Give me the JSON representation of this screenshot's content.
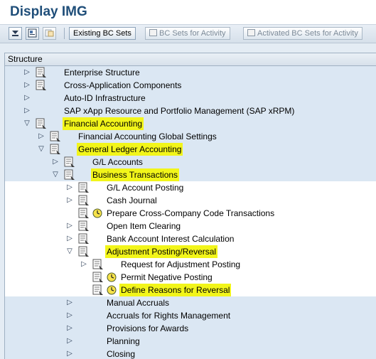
{
  "window": {
    "title": "Display IMG"
  },
  "toolbar": {
    "existing_bc_sets": "Existing BC Sets",
    "bc_sets_for_activity": "BC Sets for Activity",
    "activated_bc_sets_for_activity": "Activated BC Sets for Activity"
  },
  "tree": {
    "header": "Structure",
    "rows": [
      {
        "label": "Enterprise Structure",
        "level": 0,
        "expand": "collapsed",
        "icon": "doc",
        "clock": false,
        "highlight": false,
        "band": true
      },
      {
        "label": "Cross-Application Components",
        "level": 0,
        "expand": "collapsed",
        "icon": "doc",
        "clock": false,
        "highlight": false,
        "band": true
      },
      {
        "label": "Auto-ID Infrastructure",
        "level": 0,
        "expand": "collapsed",
        "icon": "none",
        "clock": false,
        "highlight": false,
        "band": true
      },
      {
        "label": "SAP xApp Resource and Portfolio Management (SAP xRPM)",
        "level": 0,
        "expand": "collapsed",
        "icon": "none",
        "clock": false,
        "highlight": false,
        "band": true
      },
      {
        "label": "Financial Accounting",
        "level": 0,
        "expand": "expanded",
        "icon": "doc",
        "clock": false,
        "highlight": true,
        "band": true
      },
      {
        "label": "Financial Accounting Global Settings",
        "level": 1,
        "expand": "collapsed",
        "icon": "doc",
        "clock": false,
        "highlight": false,
        "band": true
      },
      {
        "label": "General Ledger Accounting",
        "level": 1,
        "expand": "expanded",
        "icon": "doc",
        "clock": false,
        "highlight": true,
        "band": true
      },
      {
        "label": "G/L Accounts",
        "level": 2,
        "expand": "collapsed",
        "icon": "doc",
        "clock": false,
        "highlight": false,
        "band": true
      },
      {
        "label": "Business Transactions",
        "level": 2,
        "expand": "expanded",
        "icon": "doc",
        "clock": false,
        "highlight": true,
        "band": true
      },
      {
        "label": "G/L Account Posting",
        "level": 3,
        "expand": "collapsed",
        "icon": "doc",
        "clock": false,
        "highlight": false,
        "band": false
      },
      {
        "label": "Cash Journal",
        "level": 3,
        "expand": "collapsed",
        "icon": "doc",
        "clock": false,
        "highlight": false,
        "band": false
      },
      {
        "label": "Prepare Cross-Company Code Transactions",
        "level": 3,
        "expand": "none",
        "icon": "doc",
        "clock": true,
        "highlight": false,
        "band": false
      },
      {
        "label": "Open Item Clearing",
        "level": 3,
        "expand": "collapsed",
        "icon": "doc",
        "clock": false,
        "highlight": false,
        "band": false
      },
      {
        "label": "Bank Account Interest Calculation",
        "level": 3,
        "expand": "collapsed",
        "icon": "doc",
        "clock": false,
        "highlight": false,
        "band": false
      },
      {
        "label": "Adjustment Posting/Reversal",
        "level": 3,
        "expand": "expanded",
        "icon": "doc",
        "clock": false,
        "highlight": true,
        "band": false
      },
      {
        "label": "Request for Adjustment Posting",
        "level": 4,
        "expand": "collapsed",
        "icon": "doc",
        "clock": false,
        "highlight": false,
        "band": false
      },
      {
        "label": "Permit Negative Posting",
        "level": 4,
        "expand": "none",
        "icon": "doc",
        "clock": true,
        "highlight": false,
        "band": false
      },
      {
        "label": "Define Reasons for Reversal",
        "level": 4,
        "expand": "none",
        "icon": "doc",
        "clock": true,
        "highlight": true,
        "band": false
      },
      {
        "label": "Manual Accruals",
        "level": 3,
        "expand": "collapsed",
        "icon": "none",
        "clock": false,
        "highlight": false,
        "band": true
      },
      {
        "label": "Accruals for Rights Management",
        "level": 3,
        "expand": "collapsed",
        "icon": "none",
        "clock": false,
        "highlight": false,
        "band": true
      },
      {
        "label": "Provisions for Awards",
        "level": 3,
        "expand": "collapsed",
        "icon": "none",
        "clock": false,
        "highlight": false,
        "band": true
      },
      {
        "label": "Planning",
        "level": 3,
        "expand": "collapsed",
        "icon": "none",
        "clock": false,
        "highlight": false,
        "band": true
      },
      {
        "label": "Closing",
        "level": 3,
        "expand": "collapsed",
        "icon": "none",
        "clock": false,
        "highlight": false,
        "band": true
      }
    ]
  }
}
